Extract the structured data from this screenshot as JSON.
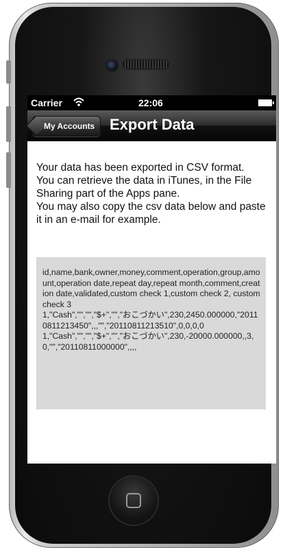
{
  "status_bar": {
    "carrier": "Carrier",
    "wifi_icon": "wifi-icon",
    "time": "22:06",
    "battery_icon": "battery-icon"
  },
  "nav": {
    "back_label": "My Accounts",
    "title": "Export Data"
  },
  "message": {
    "lines": [
      "Your data has been exported in CSV format.",
      "You can retrieve the data in iTunes, in the File Sharing part of the Apps pane.",
      "You may also copy the csv data below and paste it in an e-mail for example."
    ]
  },
  "csv": {
    "text": "id,name,bank,owner,money,comment,operation,group,amount,operation date,repeat day,repeat month,comment,creation date,validated,custom check 1,custom check 2, custom check 3\n1,\"Cash\",\"\",\"\",\"$+\",\"\",\"おこづかい\",230,2450.000000,\"20110811213450\",,,\"\",\"20110811213510\",0,0,0,0\n1,\"Cash\",\"\",\"\",\"$+\",\"\",\"おこづかい\",230,-20000.000000,,3,0,\"\",\"20110811000000\",,,,"
  },
  "device": {
    "home_button_icon": "home-button-icon",
    "camera_icon": "camera-icon",
    "speaker_icon": "speaker-icon"
  }
}
